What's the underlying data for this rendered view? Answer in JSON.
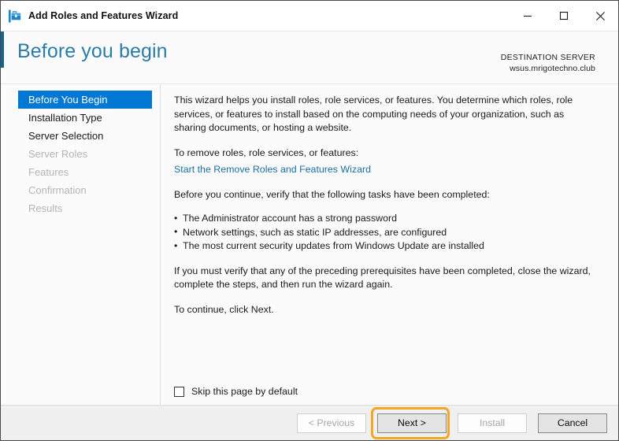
{
  "window": {
    "title": "Add Roles and Features Wizard",
    "app_icon": "toolbox-icon",
    "controls": {
      "minimize": "minimize-icon",
      "maximize": "maximize-icon",
      "close": "close-icon"
    }
  },
  "header": {
    "page_title": "Before you begin",
    "destination_label": "DESTINATION SERVER",
    "destination_server": "wsus.mrigotechno.club"
  },
  "sidebar": {
    "items": [
      {
        "label": "Before You Begin",
        "state": "selected"
      },
      {
        "label": "Installation Type",
        "state": "enabled"
      },
      {
        "label": "Server Selection",
        "state": "enabled"
      },
      {
        "label": "Server Roles",
        "state": "disabled"
      },
      {
        "label": "Features",
        "state": "disabled"
      },
      {
        "label": "Confirmation",
        "state": "disabled"
      },
      {
        "label": "Results",
        "state": "disabled"
      }
    ]
  },
  "content": {
    "intro": "This wizard helps you install roles, role services, or features. You determine which roles, role services, or features to install based on the computing needs of your organization, such as sharing documents, or hosting a website.",
    "remove_prompt": "To remove roles, role services, or features:",
    "remove_link": "Start the Remove Roles and Features Wizard",
    "verify_prompt": "Before you continue, verify that the following tasks have been completed:",
    "tasks": [
      "The Administrator account has a strong password",
      "Network settings, such as static IP addresses, are configured",
      "The most current security updates from Windows Update are installed"
    ],
    "prerequisites_note": "If you must verify that any of the preceding prerequisites have been completed, close the wizard, complete the steps, and then run the wizard again.",
    "continue_note": "To continue, click Next.",
    "skip_checkbox_label": "Skip this page by default",
    "skip_checkbox_checked": false
  },
  "footer": {
    "buttons": [
      {
        "label": "< Previous",
        "state": "disabled",
        "highlighted": false
      },
      {
        "label": "Next >",
        "state": "enabled",
        "highlighted": true
      },
      {
        "label": "Install",
        "state": "disabled",
        "highlighted": false
      },
      {
        "label": "Cancel",
        "state": "enabled",
        "highlighted": false
      }
    ]
  },
  "colors": {
    "accent_blue": "#0078d4",
    "title_blue": "#2b7ca8",
    "link_blue": "#1a6fa3",
    "left_accent": "#18628f",
    "highlight_orange": "#f5a623",
    "footer_bg": "#f0f0f0",
    "panel_bg": "#fbfbfb"
  }
}
